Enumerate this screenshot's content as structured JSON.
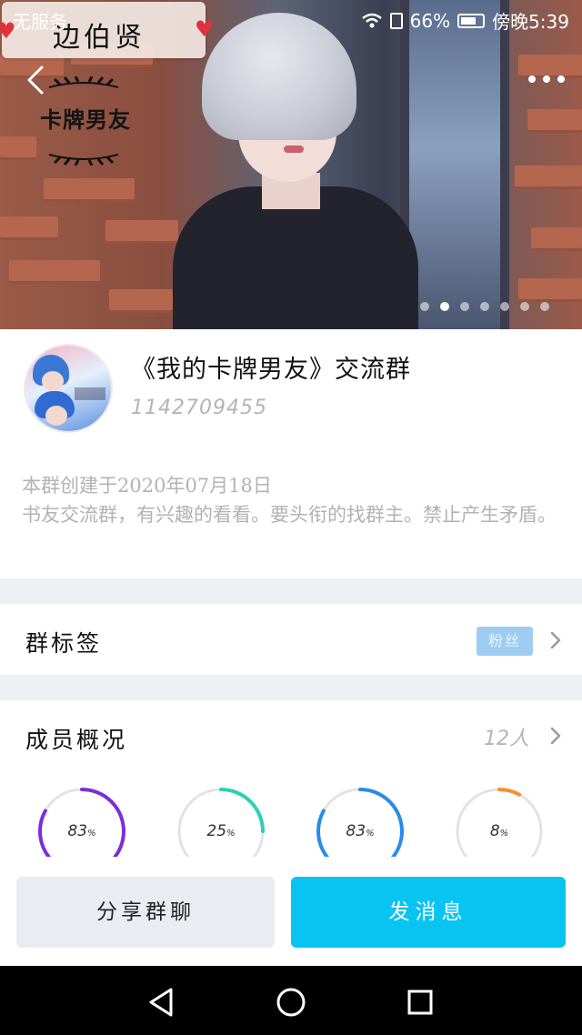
{
  "status_bar": {
    "carrier": "无服务",
    "battery": "66%",
    "time": "傍晚5:39"
  },
  "hero": {
    "sticker_text": "边伯贤",
    "tag_text": "卡牌男友",
    "pages_total": 7,
    "page_active": 2
  },
  "group": {
    "name": "《我的卡牌男友》交流群",
    "id": "1142709455",
    "desc_line1": "本群创建于2020年07月18日",
    "desc_line2": "书友交流群，有兴趣的看看。要头衔的找群主。禁止产生矛盾。"
  },
  "tags": {
    "label": "群标签",
    "chip": "粉丝"
  },
  "members": {
    "label": "成员概况",
    "count": "12人",
    "rings": [
      {
        "value": "83",
        "unit": "%",
        "percent": 83,
        "color": "#7b2fd6"
      },
      {
        "value": "25",
        "unit": "%",
        "percent": 25,
        "color": "#2ccfb8"
      },
      {
        "value": "83",
        "unit": "%",
        "percent": 83,
        "color": "#2a8be8"
      },
      {
        "value": "8",
        "unit": "%",
        "percent": 8,
        "color": "#f5902a"
      }
    ]
  },
  "actions": {
    "share": "分享群聊",
    "send": "发消息"
  },
  "icons": {
    "back": "chevron-left-icon",
    "more": "more-dots-icon",
    "wifi": "wifi-icon",
    "battery": "battery-icon",
    "nav_back": "triangle-back-icon",
    "nav_home": "circle-home-icon",
    "nav_recent": "square-recent-icon"
  }
}
